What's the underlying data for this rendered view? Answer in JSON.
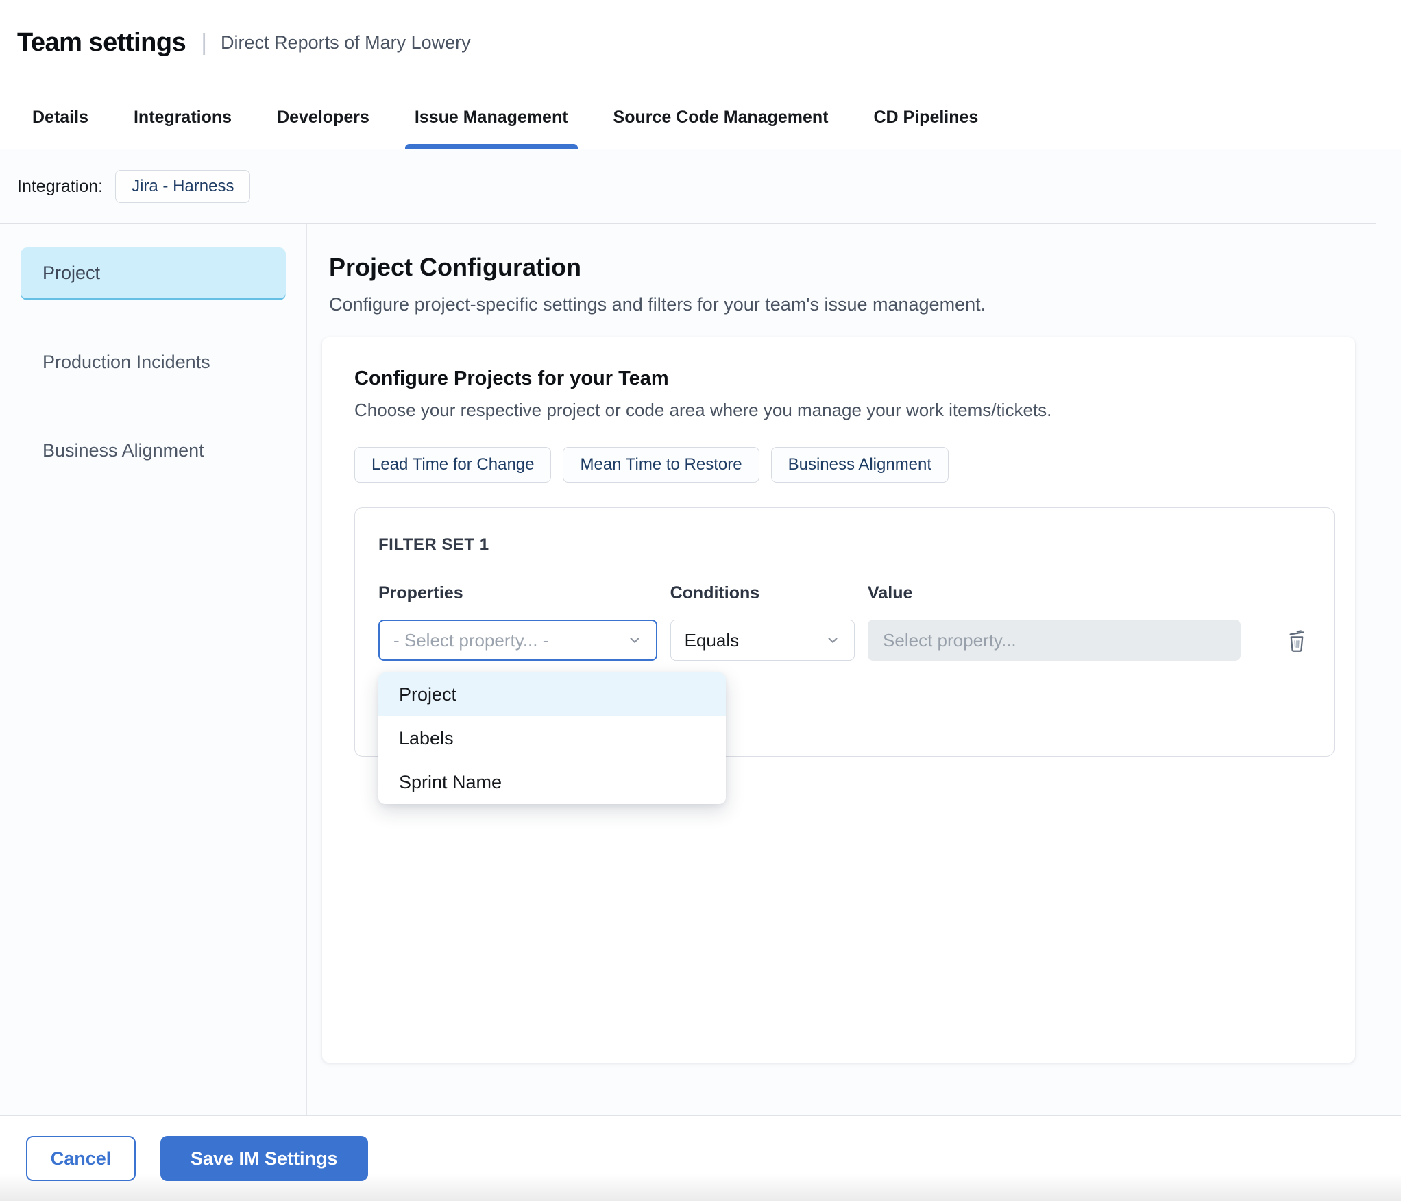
{
  "header": {
    "title": "Team settings",
    "separator": "|",
    "subtitle": "Direct Reports of Mary Lowery"
  },
  "tabs": [
    {
      "label": "Details",
      "active": false
    },
    {
      "label": "Integrations",
      "active": false
    },
    {
      "label": "Developers",
      "active": false
    },
    {
      "label": "Issue Management",
      "active": true
    },
    {
      "label": "Source Code Management",
      "active": false
    },
    {
      "label": "CD Pipelines",
      "active": false
    }
  ],
  "integration": {
    "label": "Integration:",
    "badge": "Jira - Harness"
  },
  "sidebar": {
    "items": [
      {
        "label": "Project",
        "active": true
      },
      {
        "label": "Production Incidents",
        "active": false
      },
      {
        "label": "Business Alignment",
        "active": false
      }
    ]
  },
  "main": {
    "heading": "Project Configuration",
    "description": "Configure project-specific settings and filters for your team's issue management.",
    "card": {
      "heading": "Configure Projects for your Team",
      "description": "Choose your respective project or code area where you manage your work items/tickets.",
      "pills": [
        "Lead Time for Change",
        "Mean Time to Restore",
        "Business Alignment"
      ],
      "filter_set": {
        "title": "FILTER SET 1",
        "columns": {
          "properties": "Properties",
          "conditions": "Conditions",
          "value": "Value"
        },
        "property_placeholder": "- Select property... -",
        "condition_value": "Equals",
        "value_placeholder": "Select property...",
        "dropdown_options": [
          "Project",
          "Labels",
          "Sprint Name"
        ],
        "dropdown_highlighted_index": 0
      }
    }
  },
  "footer": {
    "cancel": "Cancel",
    "save": "Save IM Settings"
  },
  "colors": {
    "accent": "#3b73d1",
    "active_sidebar_bg": "#cdeefa",
    "active_sidebar_border": "#66c0e6",
    "dropdown_highlight": "#e9f5fc",
    "value_field_bg": "#e7ebed"
  }
}
